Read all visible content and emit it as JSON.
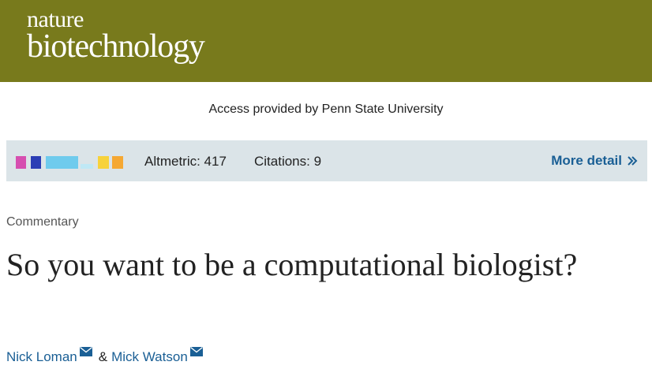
{
  "masthead": {
    "logo_line1": "nature",
    "logo_line2": "biotechnology",
    "background_color": "#787a1c"
  },
  "access": {
    "text": "Access provided by Penn State University"
  },
  "metrics": {
    "altmetric_label": "Altmetric: 417",
    "citations_label": "Citations: 9",
    "more_detail_label": "More detail",
    "more_detail_icon": "double-chevron-right-icon",
    "badge_colors": [
      "#d64fb0",
      "#2b3eb5",
      "#6fcbed",
      "#bfe8f5",
      "#f7d23b",
      "#f5a833"
    ]
  },
  "article": {
    "type": "Commentary",
    "title": "So you want to be a computational biologist?",
    "authors": [
      {
        "name": "Nick Loman",
        "icon": "envelope-icon"
      },
      {
        "name": "Mick Watson",
        "icon": "envelope-icon"
      }
    ],
    "separator": "&"
  }
}
